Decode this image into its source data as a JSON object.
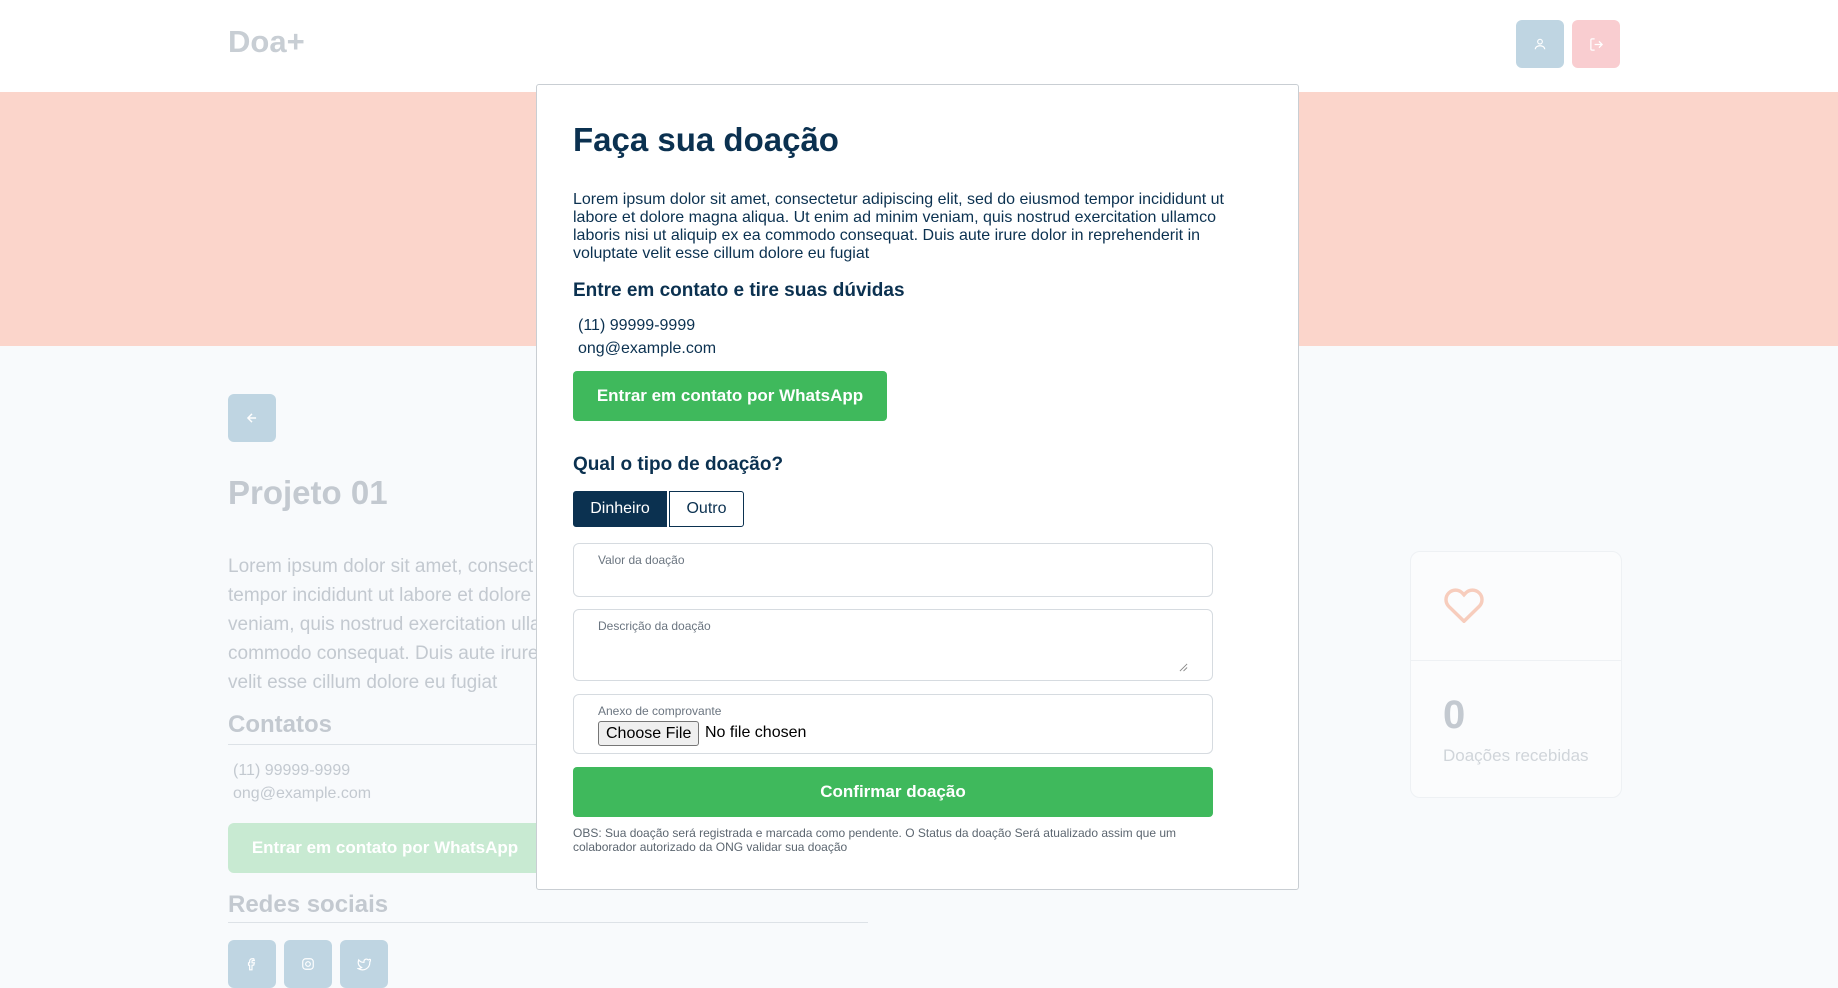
{
  "header": {
    "brand": "Doa+"
  },
  "page": {
    "title": "Projeto 01",
    "description": "Lorem ipsum dolor sit amet, consect\ntempor incididunt ut labore et dolore\nveniam, quis nostrud exercitation ulla\ncommodo consequat. Duis aute irure\nvelit esse cillum dolore eu fugiat",
    "contacts_title": "Contatos",
    "phone": "(11) 99999-9999",
    "email": "ong@example.com",
    "whatsapp_label": "Entrar em contato por WhatsApp",
    "social_title": "Redes sociais",
    "stats": {
      "count": "0",
      "label": "Doações recebidas"
    }
  },
  "modal": {
    "title": "Faça sua doação",
    "description": "Lorem ipsum dolor sit amet, consectetur adipiscing elit, sed do eiusmod tempor incididunt ut labore et dolore magna aliqua. Ut enim ad minim veniam, quis nostrud exercitation ullamco laboris nisi ut aliquip ex ea commodo consequat. Duis aute irure dolor in reprehenderit in voluptate velit esse cillum dolore eu fugiat",
    "contact_title": "Entre em contato e tire suas dúvidas",
    "phone": "(11) 99999-9999",
    "email": "ong@example.com",
    "whatsapp_label": "Entrar em contato por WhatsApp",
    "type_question": "Qual o tipo de doação?",
    "types": [
      "Dinheiro",
      "Outro"
    ],
    "selected_type": "Dinheiro",
    "fields": {
      "value_label": "Valor da doação",
      "description_label": "Descrição da doação",
      "attachment_label": "Anexo de comprovante",
      "file_button": "Choose File",
      "file_status": "No file chosen"
    },
    "confirm_label": "Confirmar doação",
    "note": "OBS: Sua doação será registrada e marcada como pendente. O Status da doação Será atualizado assim que um colaborador autorizado da ONG validar sua doação"
  },
  "colors": {
    "primary": "#0b3150",
    "success": "#3fb95c",
    "hero": "#fbd5cb"
  },
  "icons": [
    "user-icon",
    "logout-icon",
    "arrow-left-icon",
    "heart-icon",
    "facebook-icon",
    "instagram-icon",
    "twitter-icon"
  ]
}
